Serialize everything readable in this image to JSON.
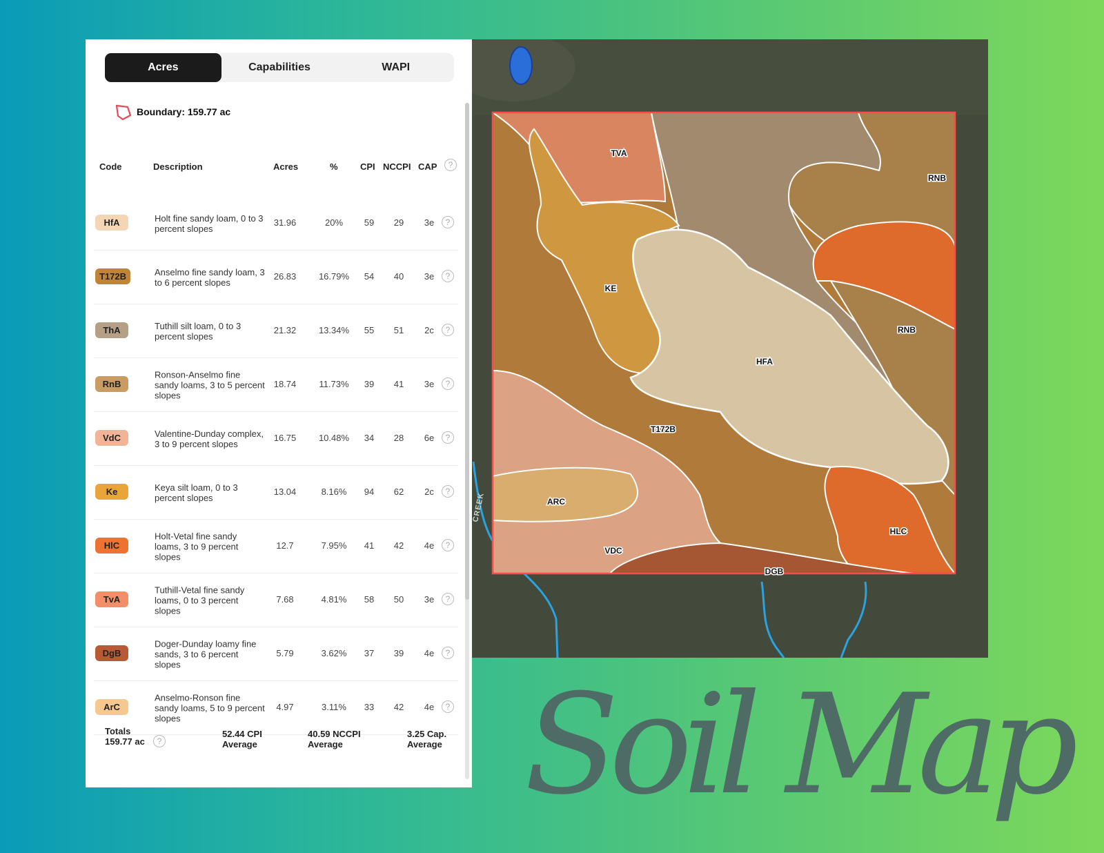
{
  "tabs": [
    "Acres",
    "Capabilities",
    "WAPI"
  ],
  "boundary_label": "Boundary: 159.77 ac",
  "columns": {
    "code": "Code",
    "description": "Description",
    "acres": "Acres",
    "percent": "%",
    "cpi": "CPI",
    "nccpi": "NCCPI",
    "cap": "CAP"
  },
  "rows": [
    {
      "code": "HfA",
      "color": "#f5d6b4",
      "description": "Holt fine sandy loam, 0 to 3 percent slopes",
      "acres": "31.96",
      "percent": "20%",
      "cpi": "59",
      "nccpi": "29",
      "cap": "3e"
    },
    {
      "code": "T172B",
      "color": "#bf8437",
      "description": "Anselmo fine sandy loam, 3 to 6 percent slopes",
      "acres": "26.83",
      "percent": "16.79%",
      "cpi": "54",
      "nccpi": "40",
      "cap": "3e"
    },
    {
      "code": "ThA",
      "color": "#b59f86",
      "description": "Tuthill silt loam, 0 to 3 percent slopes",
      "acres": "21.32",
      "percent": "13.34%",
      "cpi": "55",
      "nccpi": "51",
      "cap": "2c"
    },
    {
      "code": "RnB",
      "color": "#c99c62",
      "description": "Ronson-Anselmo fine sandy loams, 3 to 5 percent slopes",
      "acres": "18.74",
      "percent": "11.73%",
      "cpi": "39",
      "nccpi": "41",
      "cap": "3e"
    },
    {
      "code": "VdC",
      "color": "#f2b496",
      "description": "Valentine-Dunday complex, 3 to 9 percent slopes",
      "acres": "16.75",
      "percent": "10.48%",
      "cpi": "34",
      "nccpi": "28",
      "cap": "6e"
    },
    {
      "code": "Ke",
      "color": "#e9a53a",
      "description": "Keya silt loam, 0 to 3 percent slopes",
      "acres": "13.04",
      "percent": "8.16%",
      "cpi": "94",
      "nccpi": "62",
      "cap": "2c"
    },
    {
      "code": "HlC",
      "color": "#ee7230",
      "description": "Holt-Vetal fine sandy loams, 3 to 9 percent slopes",
      "acres": "12.7",
      "percent": "7.95%",
      "cpi": "41",
      "nccpi": "42",
      "cap": "4e"
    },
    {
      "code": "TvA",
      "color": "#f28e68",
      "description": "Tuthill-Vetal fine sandy loams, 0 to 3 percent slopes",
      "acres": "7.68",
      "percent": "4.81%",
      "cpi": "58",
      "nccpi": "50",
      "cap": "3e"
    },
    {
      "code": "DgB",
      "color": "#b85a36",
      "description": "Doger-Dunday loamy fine sands, 3 to 6 percent slopes",
      "acres": "5.79",
      "percent": "3.62%",
      "cpi": "37",
      "nccpi": "39",
      "cap": "4e"
    },
    {
      "code": "ArC",
      "color": "#f4c88e",
      "description": "Anselmo-Ronson fine sandy loams, 5 to 9 percent slopes",
      "acres": "4.97",
      "percent": "3.11%",
      "cpi": "33",
      "nccpi": "42",
      "cap": "4e"
    }
  ],
  "totals": {
    "label": "Totals",
    "acres": "159.77 ac",
    "cpi_value": "52.44 CPI",
    "nccpi_value": "40.59 NCCPI",
    "cap_value": "3.25 Cap.",
    "average_label": "Average"
  },
  "map": {
    "labels": {
      "tva": "TVA",
      "rnb1": "RNB",
      "ke": "KE",
      "rnb2": "RNB",
      "hfa": "HFA",
      "t172b": "T172B",
      "arc": "ARC",
      "hlc": "HLC",
      "vdc": "VDC",
      "dgb": "DGB"
    },
    "creek_label": "CREEK"
  },
  "help_icon_glyph": "?",
  "title": "Soil Map"
}
